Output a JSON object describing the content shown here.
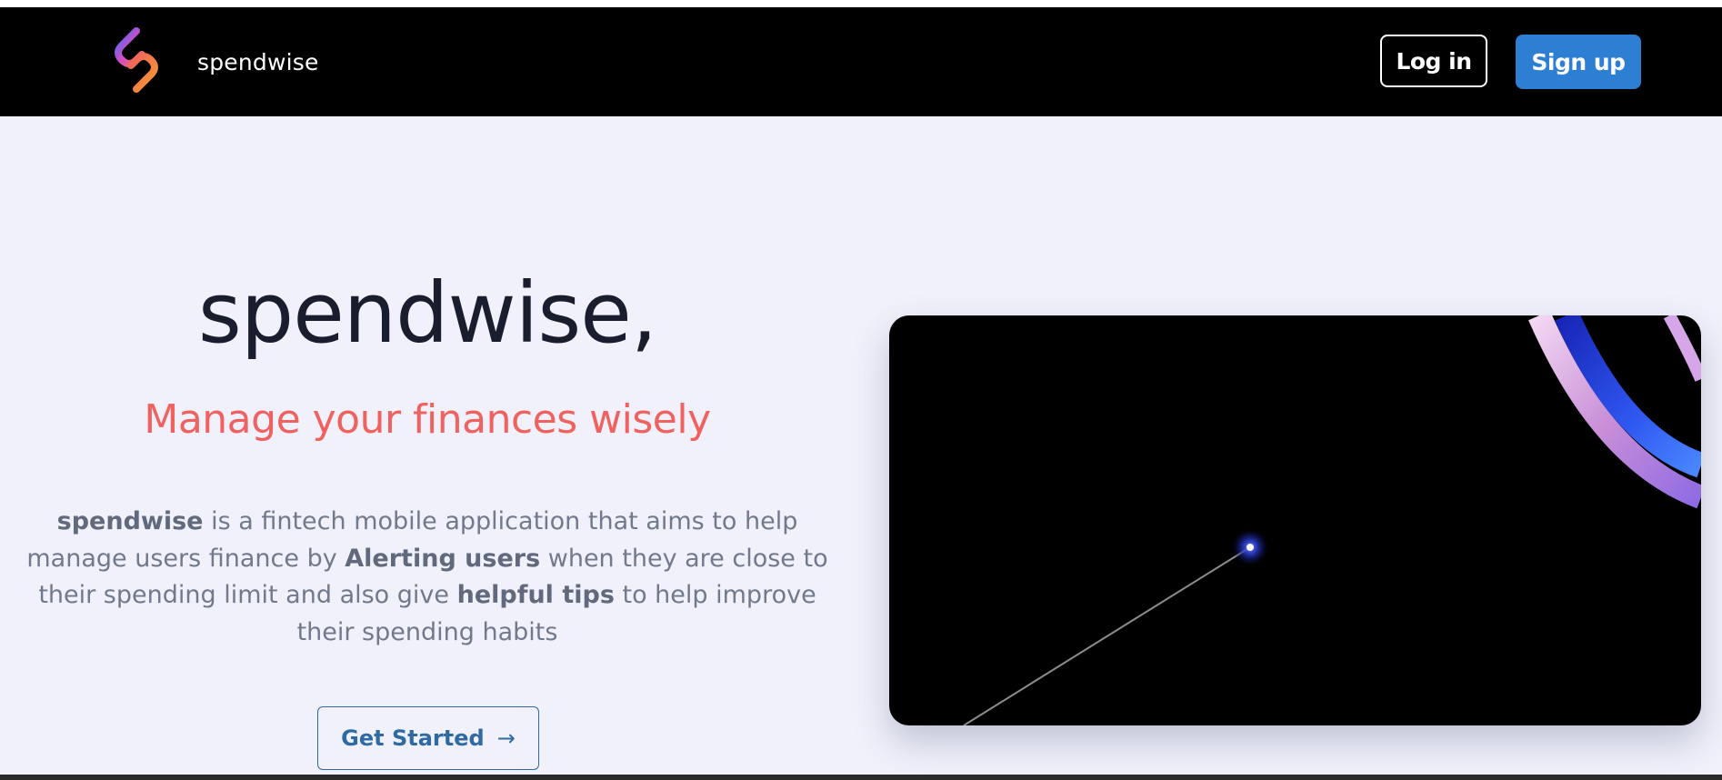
{
  "header": {
    "brand": "spendwise",
    "login_label": "Log in",
    "signup_label": "Sign up"
  },
  "hero": {
    "title": "spendwise,",
    "subtitle": "Manage your finances wisely",
    "description": {
      "p1_bold": "spendwise",
      "p1": " is a fintech mobile application that aims to help manage users finance by ",
      "p2_bold": "Alerting users",
      "p2": " when they are close to their spending limit and also give ",
      "p3_bold": "helpful tips",
      "p3": " to help improve their spending habits"
    },
    "cta_label": "Get Started",
    "cta_icon": "arrow-right-icon"
  },
  "colors": {
    "navbar_bg": "#000000",
    "page_bg": "#f0f1fb",
    "accent_blue": "#2d7fd3",
    "subtitle_red": "#f0625f",
    "cta_blue": "#2f6aa3"
  }
}
